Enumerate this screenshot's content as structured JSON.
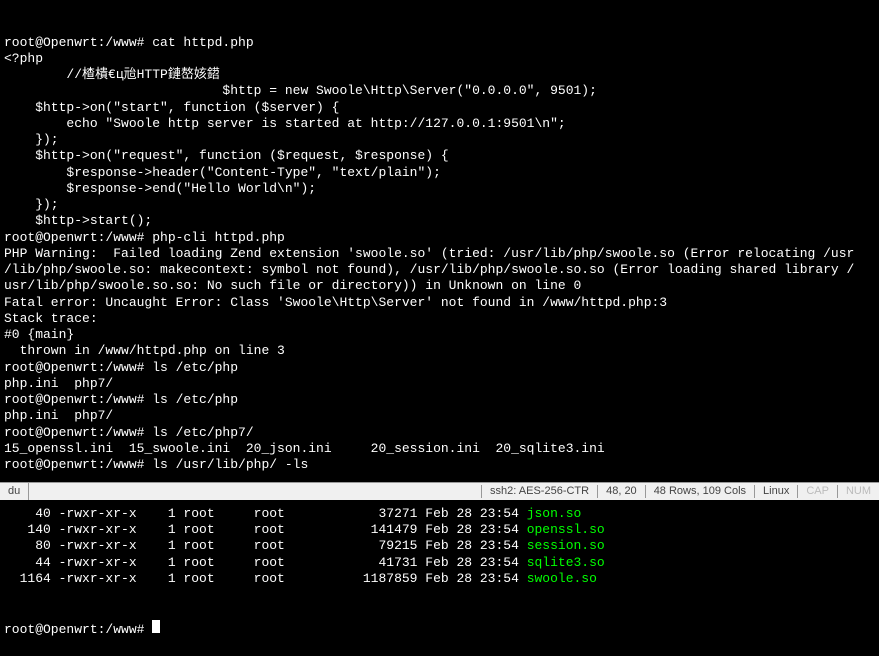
{
  "terminal": {
    "lines": [
      {
        "text": "root@Openwrt:/www# cat httpd.php",
        "class": ""
      },
      {
        "text": "<?php",
        "class": ""
      },
      {
        "text": "        //楂樻€ц兘HTTP鏈嶅姟鍣​",
        "class": ""
      },
      {
        "text": "                            $http = new Swoole\\Http\\Server(\"0.0.0.0\", 9501);",
        "class": ""
      },
      {
        "text": "",
        "class": ""
      },
      {
        "text": "    $http->on(\"start\", function ($server) {",
        "class": ""
      },
      {
        "text": "        echo \"Swoole http server is started at http://127.0.0.1:9501\\n\";",
        "class": ""
      },
      {
        "text": "    });",
        "class": ""
      },
      {
        "text": "",
        "class": ""
      },
      {
        "text": "    $http->on(\"request\", function ($request, $response) {",
        "class": ""
      },
      {
        "text": "        $response->header(\"Content-Type\", \"text/plain\");",
        "class": ""
      },
      {
        "text": "        $response->end(\"Hello World\\n\");",
        "class": ""
      },
      {
        "text": "    });",
        "class": ""
      },
      {
        "text": "",
        "class": ""
      },
      {
        "text": "    $http->start();",
        "class": ""
      },
      {
        "text": "root@Openwrt:/www# php-cli httpd.php",
        "class": ""
      },
      {
        "text": "PHP Warning:  Failed loading Zend extension 'swoole.so' (tried: /usr/lib/php/swoole.so (Error relocating /usr",
        "class": ""
      },
      {
        "text": "/lib/php/swoole.so: makecontext: symbol not found), /usr/lib/php/swoole.so.so (Error loading shared library /",
        "class": ""
      },
      {
        "text": "usr/lib/php/swoole.so.so: No such file or directory)) in Unknown on line 0",
        "class": ""
      },
      {
        "text": "",
        "class": ""
      },
      {
        "text": "Fatal error: Uncaught Error: Class 'Swoole\\Http\\Server' not found in /www/httpd.php:3",
        "class": ""
      },
      {
        "text": "Stack trace:",
        "class": ""
      },
      {
        "text": "#0 {main}",
        "class": ""
      },
      {
        "text": "  thrown in /www/httpd.php on line 3",
        "class": ""
      },
      {
        "text": "root@Openwrt:/www# ls /etc/php",
        "class": ""
      },
      {
        "text": "php.ini  php7/",
        "class": ""
      },
      {
        "text": "root@Openwrt:/www# ls /etc/php",
        "class": ""
      },
      {
        "text": "php.ini  php7/",
        "class": ""
      },
      {
        "text": "root@Openwrt:/www# ls /etc/php7/",
        "class": ""
      },
      {
        "text": "15_openssl.ini  15_swoole.ini  20_json.ini     20_session.ini  20_sqlite3.ini",
        "class": ""
      },
      {
        "text": "root@Openwrt:/www# ls /usr/lib/php/ -ls",
        "class": ""
      }
    ],
    "file_listing": [
      {
        "size": "40",
        "perms": "-rwxr-xr-x",
        "links": "1",
        "owner": "root",
        "group": "root",
        "bytes": "37271",
        "date": "Feb 28 23:54",
        "name": "json.so"
      },
      {
        "size": "140",
        "perms": "-rwxr-xr-x",
        "links": "1",
        "owner": "root",
        "group": "root",
        "bytes": "141479",
        "date": "Feb 28 23:54",
        "name": "openssl.so"
      },
      {
        "size": "80",
        "perms": "-rwxr-xr-x",
        "links": "1",
        "owner": "root",
        "group": "root",
        "bytes": "79215",
        "date": "Feb 28 23:54",
        "name": "session.so"
      },
      {
        "size": "44",
        "perms": "-rwxr-xr-x",
        "links": "1",
        "owner": "root",
        "group": "root",
        "bytes": "41731",
        "date": "Feb 28 23:54",
        "name": "sqlite3.so"
      },
      {
        "size": "1164",
        "perms": "-rwxr-xr-x",
        "links": "1",
        "owner": "root",
        "group": "root",
        "bytes": "1187859",
        "date": "Feb 28 23:54",
        "name": "swoole.so"
      }
    ],
    "prompt": "root@Openwrt:/www#"
  },
  "status": {
    "left1": "du",
    "cipher": "ssh2: AES-256-CTR",
    "pos": "48, 20",
    "size": "48 Rows, 109 Cols",
    "sys": "Linux",
    "cap": "CAP",
    "num": "NUM"
  }
}
